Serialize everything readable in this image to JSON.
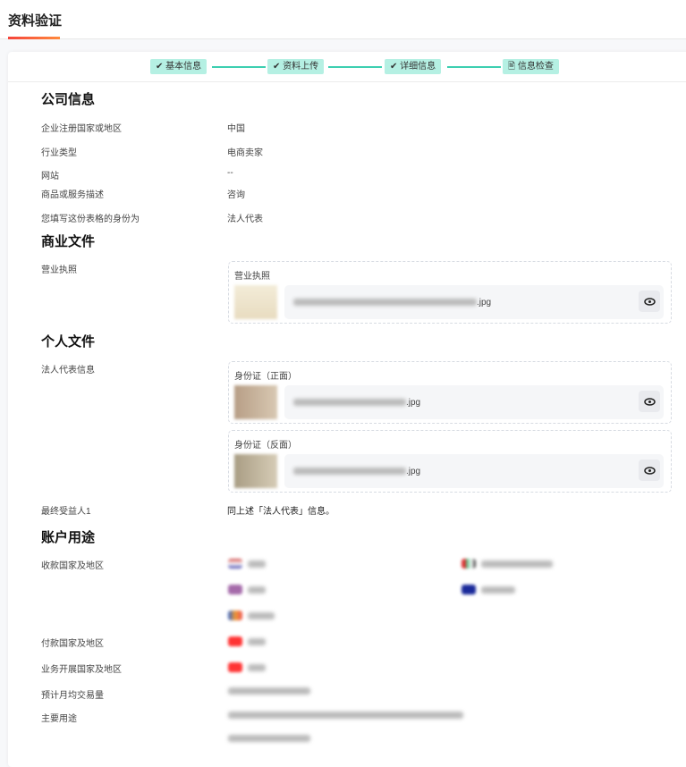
{
  "header": {
    "title": "资料验证"
  },
  "steps": [
    {
      "label": "基本信息",
      "icon": "check-icon"
    },
    {
      "label": "资料上传",
      "icon": "check-icon"
    },
    {
      "label": "详细信息",
      "icon": "check-icon"
    },
    {
      "label": "信息检查",
      "icon": "edit-doc-icon"
    }
  ],
  "company": {
    "heading": "公司信息",
    "rows": [
      {
        "label": "企业注册国家或地区",
        "value": "中国"
      },
      {
        "label": "行业类型",
        "value": "电商卖家"
      },
      {
        "label": "网站",
        "value": "--"
      },
      {
        "label": "商品或服务描述",
        "value": "咨询"
      },
      {
        "label": "您填写这份表格的身份为",
        "value": "法人代表"
      }
    ]
  },
  "business_docs": {
    "heading": "商业文件",
    "label": "营业执照",
    "file_caption": "营业执照",
    "file_ext": ".jpg"
  },
  "personal_docs": {
    "heading": "个人文件",
    "label": "法人代表信息",
    "front_caption": "身份证（正面）",
    "back_caption": "身份证（反面）",
    "file_ext": ".jpg",
    "beneficiary_label": "最终受益人1",
    "beneficiary_value": "同上述「法人代表」信息。"
  },
  "account": {
    "heading": "账户用途",
    "receive_label": "收款国家及地区",
    "pay_label": "付款国家及地区",
    "business_label": "业务开展国家及地区",
    "volume_label": "预计月均交易量",
    "purpose_label": "主要用途"
  },
  "colors": {
    "accent": "#3ccfb0",
    "step_bg": "#b5f0e3"
  }
}
